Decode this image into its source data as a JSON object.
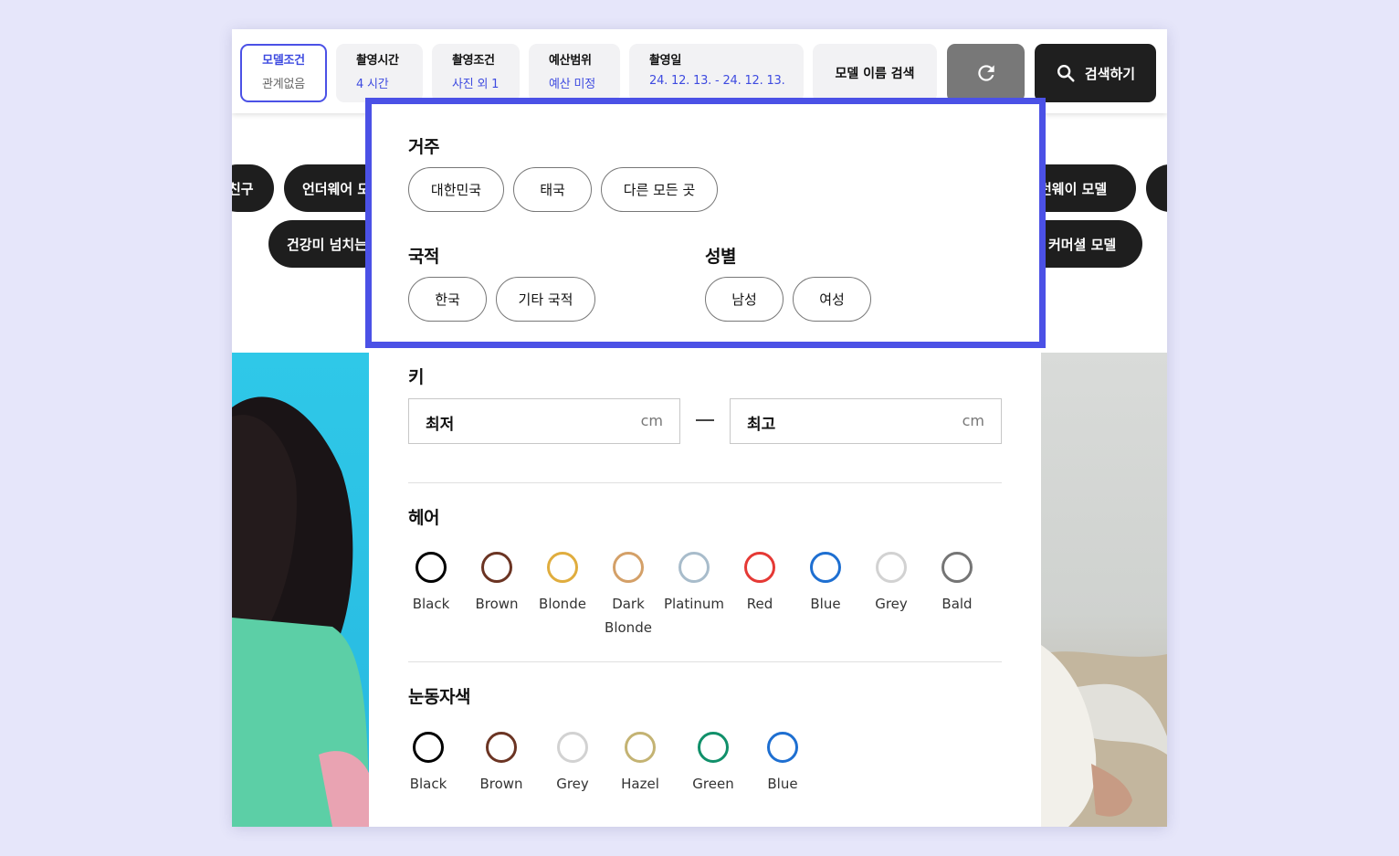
{
  "topbar": {
    "chips": [
      {
        "label": "모델조건",
        "value": "관계없음"
      },
      {
        "label": "촬영시간",
        "value": "4 시간"
      },
      {
        "label": "촬영조건",
        "value": "사진 외 1"
      },
      {
        "label": "예산범위",
        "value": "예산 미정"
      },
      {
        "label": "촬영일",
        "value": "24. 12. 13. - 24. 12. 13."
      }
    ],
    "name_search": "모델 이름 검색",
    "search_button": "검색하기"
  },
  "pills": {
    "row1": [
      "친구",
      "언더웨어 모",
      "런웨이 모델"
    ],
    "row2": [
      "건강미 넘치는",
      "커머셜 모델"
    ]
  },
  "panel": {
    "residence": {
      "title": "거주",
      "options": [
        "대한민국",
        "태국",
        "다른 모든 곳"
      ]
    },
    "nationality": {
      "title": "국적",
      "options": [
        "한국",
        "기타 국적"
      ]
    },
    "gender": {
      "title": "성별",
      "options": [
        "남성",
        "여성"
      ]
    },
    "height": {
      "title": "키",
      "min_placeholder": "최저",
      "max_placeholder": "최고",
      "unit": "cm"
    },
    "hair": {
      "title": "헤어",
      "colors": [
        {
          "name": "Black",
          "color": "#000000"
        },
        {
          "name": "Brown",
          "color": "#6b3423"
        },
        {
          "name": "Blonde",
          "color": "#e0ad3e"
        },
        {
          "name": "Dark Blonde",
          "color": "#d4a068"
        },
        {
          "name": "Platinum",
          "color": "#a8bccb"
        },
        {
          "name": "Red",
          "color": "#e53935"
        },
        {
          "name": "Blue",
          "color": "#1e6fd1"
        },
        {
          "name": "Grey",
          "color": "#d2d2d2"
        },
        {
          "name": "Bald",
          "color": "#757575"
        }
      ]
    },
    "eye": {
      "title": "눈동자색",
      "colors": [
        {
          "name": "Black",
          "color": "#000000"
        },
        {
          "name": "Brown",
          "color": "#6b3423"
        },
        {
          "name": "Grey",
          "color": "#d2d2d2"
        },
        {
          "name": "Hazel",
          "color": "#c4b373"
        },
        {
          "name": "Green",
          "color": "#11906a"
        },
        {
          "name": "Blue",
          "color": "#1e6fd1"
        }
      ]
    }
  },
  "colors": {
    "accent": "#4b51e6",
    "accent_text": "#3e4be0",
    "dark": "#1f1f1f"
  }
}
